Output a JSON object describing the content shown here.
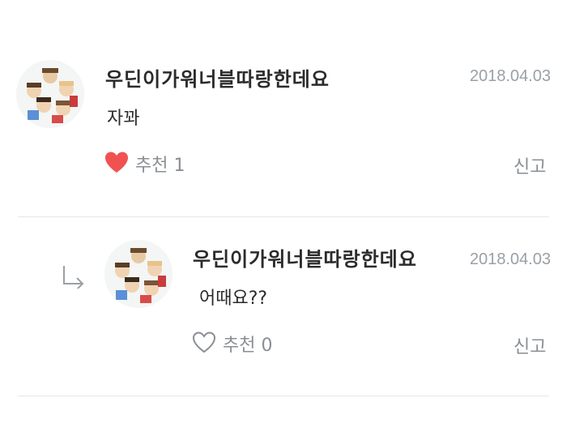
{
  "comments": [
    {
      "username": "우딘이가워너블따랑한데요",
      "date": "2018.04.03",
      "text": "자꽈",
      "like_label": "추천 1",
      "liked": true,
      "report_label": "신고"
    }
  ],
  "replies": [
    {
      "username": "우딘이가워너블따랑한데요",
      "date": "2018.04.03",
      "text": "어때요??",
      "like_label": "추천 0",
      "liked": false,
      "report_label": "신고"
    }
  ],
  "icons": {
    "heart_filled": "heart-filled-icon",
    "heart_outline": "heart-outline-icon",
    "reply": "reply-arrow-icon"
  },
  "colors": {
    "heart_active": "#f05252",
    "muted": "#8a8f94",
    "date": "#9aa0a6",
    "divider": "#e3e6e8"
  }
}
